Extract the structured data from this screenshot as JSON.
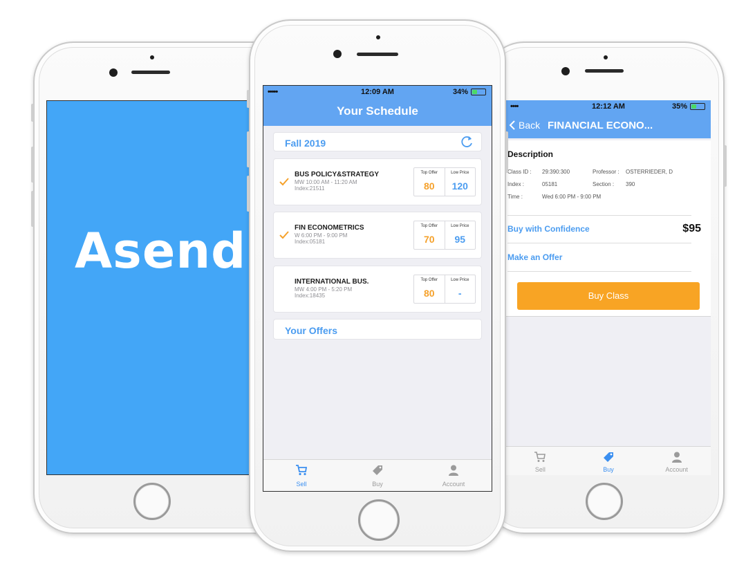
{
  "splash": {
    "logo_text": "Asend",
    "background": "#43a6f7"
  },
  "schedule_screen": {
    "status": {
      "carrier": "•••••",
      "time": "12:09 AM",
      "battery": "34%"
    },
    "title": "Your Schedule",
    "term": "Fall 2019",
    "courses": [
      {
        "name": "BUS POLICY&STRATEGY",
        "schedule": "MW 10:00 AM - 11:20 AM",
        "index": "Index:21511",
        "checked": true,
        "top_offer_label": "Top Offer",
        "low_price_label": "Low Price",
        "top_offer": "80",
        "low_price": "120"
      },
      {
        "name": "FIN ECONOMETRICS",
        "schedule": "W 6:00 PM - 9:00 PM",
        "index": "Index:05181",
        "checked": true,
        "top_offer_label": "Top Offer",
        "low_price_label": "Low Price",
        "top_offer": "70",
        "low_price": "95"
      },
      {
        "name": "INTERNATIONAL BUS.",
        "schedule": "MW 4:00 PM - 5:20 PM",
        "index": "Index:18435",
        "checked": false,
        "top_offer_label": "Top Offer",
        "low_price_label": "Low Price",
        "top_offer": "80",
        "low_price": "-"
      }
    ],
    "offers_label": "Your Offers",
    "tabs": [
      {
        "label": "Sell",
        "icon": "cart-icon",
        "active": true
      },
      {
        "label": "Buy",
        "icon": "tag-icon",
        "active": false
      },
      {
        "label": "Account",
        "icon": "person-icon",
        "active": false
      }
    ]
  },
  "detail_screen": {
    "status": {
      "carrier": "••••",
      "time": "12:12 AM",
      "battery": "35%"
    },
    "back_label": "Back",
    "title": "FINANCIAL ECONO...",
    "description_title": "Description",
    "class_id_label": "Class ID :",
    "class_id": "29:390:300",
    "professor_label": "Professor :",
    "professor": "OSTERRIEDER, D",
    "index_label": "Index :",
    "index": "05181",
    "section_label": "Section :",
    "section": "390",
    "time_label": "Time :",
    "time": "Wed 6:00 PM - 9:00 PM",
    "buy_confidence_label": "Buy with Confidence",
    "buy_confidence_price": "$95",
    "make_offer_label": "Make an Offer",
    "buy_button_label": "Buy Class",
    "tabs": [
      {
        "label": "Sell",
        "icon": "cart-icon",
        "active": false
      },
      {
        "label": "Buy",
        "icon": "tag-icon",
        "active": true
      },
      {
        "label": "Account",
        "icon": "person-icon",
        "active": false
      }
    ]
  },
  "colors": {
    "accent_blue": "#4b9cf0",
    "nav_blue": "#62a5f2",
    "accent_orange": "#f5a12b",
    "buy_button": "#f8a424"
  }
}
